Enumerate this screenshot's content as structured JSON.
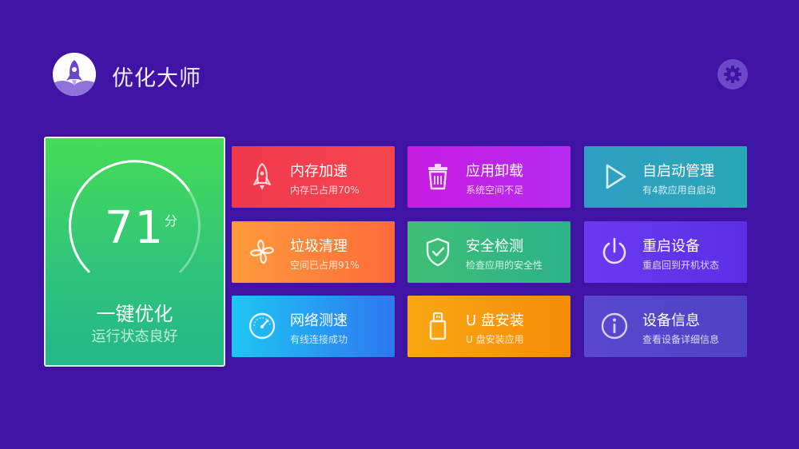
{
  "header": {
    "title": "优化大师",
    "logo_icon": "rocket-icon",
    "settings_icon": "gear-icon"
  },
  "main_card": {
    "score": "71",
    "unit": "分",
    "score_fraction": 0.71,
    "title": "一键优化",
    "subtitle": "运行状态良好"
  },
  "tiles": [
    {
      "title": "内存加速",
      "subtitle": "内存已占用70%",
      "icon": "rocket-icon",
      "colors": [
        "#f0374c",
        "#f5474f"
      ]
    },
    {
      "title": "应用卸载",
      "subtitle": "系统空间不足",
      "icon": "trash-icon",
      "colors": [
        "#c81be0",
        "#b52cf0"
      ]
    },
    {
      "title": "自启动管理",
      "subtitle": "有4款应用自启动",
      "icon": "play-icon",
      "colors": [
        "#2e9fc3",
        "#2aa8b6"
      ]
    },
    {
      "title": "垃圾清理",
      "subtitle": "空间已占用91%",
      "icon": "fan-icon",
      "colors": [
        "#ff9b3c",
        "#ff6b3a"
      ]
    },
    {
      "title": "安全检测",
      "subtitle": "检查应用的安全性",
      "icon": "shield-check-icon",
      "colors": [
        "#3fbf74",
        "#2bb28a"
      ]
    },
    {
      "title": "重启设备",
      "subtitle": "重启回到开机状态",
      "icon": "power-icon",
      "colors": [
        "#6a3af2",
        "#5a2fe6"
      ]
    },
    {
      "title": "网络测速",
      "subtitle": "有线连接成功",
      "icon": "speedometer-icon",
      "colors": [
        "#1ec6f2",
        "#2e77f0"
      ]
    },
    {
      "title": "U 盘安装",
      "subtitle": "U 盘安装应用",
      "icon": "usb-drive-icon",
      "colors": [
        "#f9a712",
        "#f58c08"
      ]
    },
    {
      "title": "设备信息",
      "subtitle": "查看设备详细信息",
      "icon": "info-icon",
      "colors": [
        "#5a48cf",
        "#4d43c4"
      ]
    }
  ]
}
